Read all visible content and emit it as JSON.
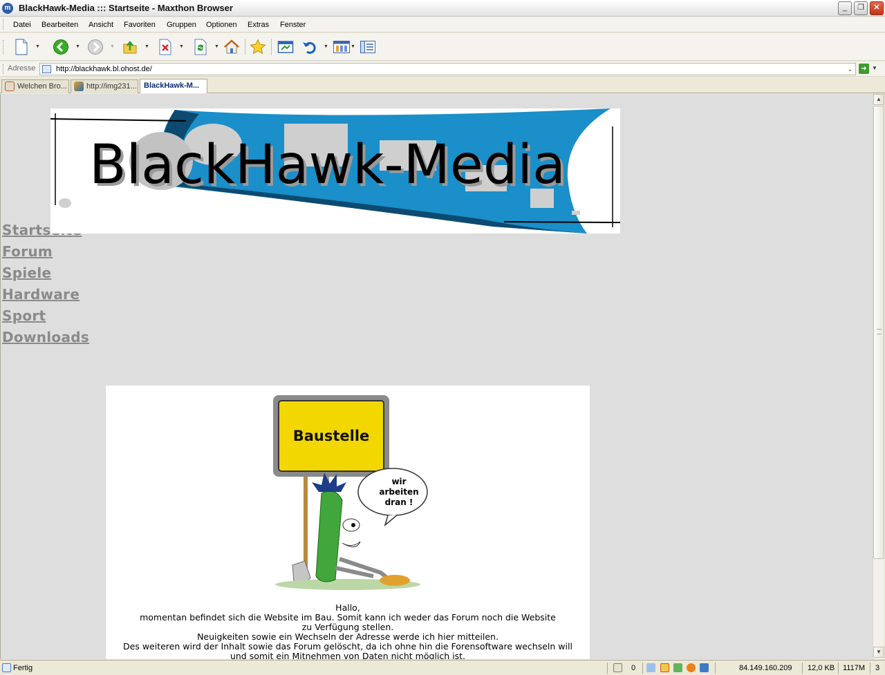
{
  "window": {
    "title": "BlackHawk-Media ::: Startseite - Maxthon Browser",
    "minimize": "_",
    "restore": "❐",
    "close": "✕"
  },
  "menu": [
    {
      "label": "Datei"
    },
    {
      "label": "Bearbeiten"
    },
    {
      "label": "Ansicht"
    },
    {
      "label": "Favoriten"
    },
    {
      "label": "Gruppen"
    },
    {
      "label": "Optionen"
    },
    {
      "label": "Extras"
    },
    {
      "label": "Fenster"
    }
  ],
  "toolbar": {
    "icons": [
      "new-page-icon",
      "back-icon",
      "forward-icon",
      "up-folder-icon",
      "stop-icon",
      "refresh-icon",
      "home-icon",
      "favorites-star-icon",
      "open-window-icon",
      "undo-icon",
      "columns-icon",
      "list-view-icon"
    ]
  },
  "address": {
    "label": "Adresse",
    "url": "http://blackhawk.bl.ohost.de/"
  },
  "tabs": [
    {
      "label": "Welchen Bro...",
      "icon": "page-icon"
    },
    {
      "label": "http://img231...",
      "icon": "image-icon"
    },
    {
      "label": "BlackHawk-M...",
      "active": true
    }
  ],
  "page": {
    "banner_text": "BlackHawk-Media",
    "nav": [
      "Startseite",
      "Forum",
      "Spiele",
      "Hardware",
      "Sport",
      "Downloads"
    ],
    "sign_text": "Baustelle",
    "bubble_text": [
      "wir",
      "arbeiten",
      "dran !"
    ],
    "message": [
      "Hallo,",
      "momentan befindet sich die Website im Bau. Somit kann ich weder das Forum noch die Website",
      "zu Verfügung stellen.",
      "Neuigkeiten sowie ein Wechseln der Adresse werde ich hier mitteilen.",
      "Des weiteren wird der Inhalt sowie das Forum gelöscht, da ich ohne hin die Forensoftware wechseln will",
      "und somit ein Mitnehmen von Daten nicht möglich ist."
    ]
  },
  "status": {
    "text": "Fertig",
    "counter": "0",
    "ip": "84.149.160.209",
    "size": "12,0 KB",
    "memory": "1117M",
    "tabs_count": "3"
  },
  "colors": {
    "banner_blue": "#1a8fc9",
    "nav_link": "#8a8a8a",
    "sign_yellow": "#f2d800",
    "page_bg": "#dedede"
  }
}
